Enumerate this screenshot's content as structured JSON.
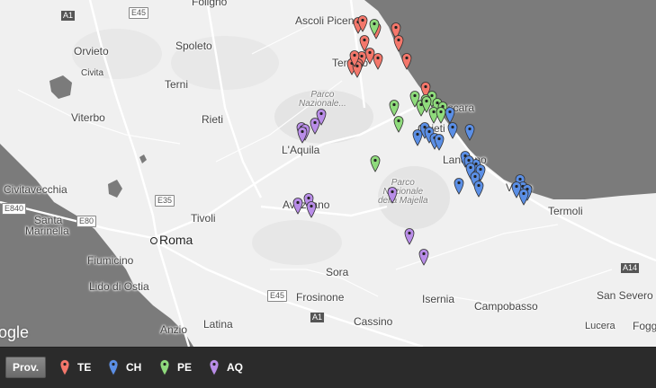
{
  "map": {
    "attribution": "ogle",
    "places": [
      {
        "id": "ascoli",
        "label": "Ascoli Piceno"
      },
      {
        "id": "foligno",
        "label": "Foligno"
      },
      {
        "id": "orvieto",
        "label": "Orvieto"
      },
      {
        "id": "spoleto",
        "label": "Spoleto"
      },
      {
        "id": "civita",
        "label": "Civita"
      },
      {
        "id": "terni",
        "label": "Terni"
      },
      {
        "id": "viterbo",
        "label": "Viterbo"
      },
      {
        "id": "rieti",
        "label": "Rieti"
      },
      {
        "id": "teramo",
        "label": "Teramo"
      },
      {
        "id": "pescara",
        "label": "Pescara"
      },
      {
        "id": "chieti",
        "label": "Chieti"
      },
      {
        "id": "laquila",
        "label": "L'Aquila"
      },
      {
        "id": "lanciano",
        "label": "Lanciano"
      },
      {
        "id": "vasto",
        "label": "Vasto"
      },
      {
        "id": "civitavecchia",
        "label": "Civitavecchia"
      },
      {
        "id": "termoli",
        "label": "Termoli"
      },
      {
        "id": "avezzano",
        "label": "Avezzano"
      },
      {
        "id": "tivoli",
        "label": "Tivoli"
      },
      {
        "id": "santa",
        "label": "Santa"
      },
      {
        "id": "marinella",
        "label": "Marinella"
      },
      {
        "id": "roma",
        "label": "Roma"
      },
      {
        "id": "fiumicino",
        "label": "Fiumicino"
      },
      {
        "id": "lidodiostia",
        "label": "Lido di Ostia"
      },
      {
        "id": "sora",
        "label": "Sora"
      },
      {
        "id": "frosinone",
        "label": "Frosinone"
      },
      {
        "id": "isernia",
        "label": "Isernia"
      },
      {
        "id": "campobasso",
        "label": "Campobasso"
      },
      {
        "id": "sansevero",
        "label": "San Severo"
      },
      {
        "id": "latina",
        "label": "Latina"
      },
      {
        "id": "cassino",
        "label": "Cassino"
      },
      {
        "id": "anzio",
        "label": "Anzio"
      },
      {
        "id": "lucera",
        "label": "Lucera"
      },
      {
        "id": "foggia",
        "label": "Fogg"
      }
    ],
    "parks": [
      {
        "id": "park-gransasso",
        "label": "Parco\nNazionale..."
      },
      {
        "id": "park-majella",
        "label": "Parco\nNazionale\ndella Majella"
      }
    ],
    "shields": [
      {
        "id": "a1-north",
        "label": "A1"
      },
      {
        "id": "e45-north",
        "label": "E45"
      },
      {
        "id": "e35",
        "label": "E35"
      },
      {
        "id": "e840",
        "label": "E840"
      },
      {
        "id": "e80",
        "label": "E80"
      },
      {
        "id": "e45-south",
        "label": "E45"
      },
      {
        "id": "a1-south",
        "label": "A1"
      },
      {
        "id": "a14",
        "label": "A14"
      }
    ]
  },
  "colors": {
    "TE": "#f4776b",
    "CH": "#5b8fe6",
    "PE": "#8fdb7c",
    "AQ": "#b98de8",
    "sea": "#7b7b7b",
    "land": "#f0f0f0"
  },
  "markers": {
    "TE": 16,
    "PE": 13,
    "CH": 22,
    "AQ": 11
  },
  "legend": {
    "button_label": "Prov.",
    "items": [
      {
        "code": "TE",
        "label": "TE"
      },
      {
        "code": "CH",
        "label": "CH"
      },
      {
        "code": "PE",
        "label": "PE"
      },
      {
        "code": "AQ",
        "label": "AQ"
      }
    ]
  }
}
